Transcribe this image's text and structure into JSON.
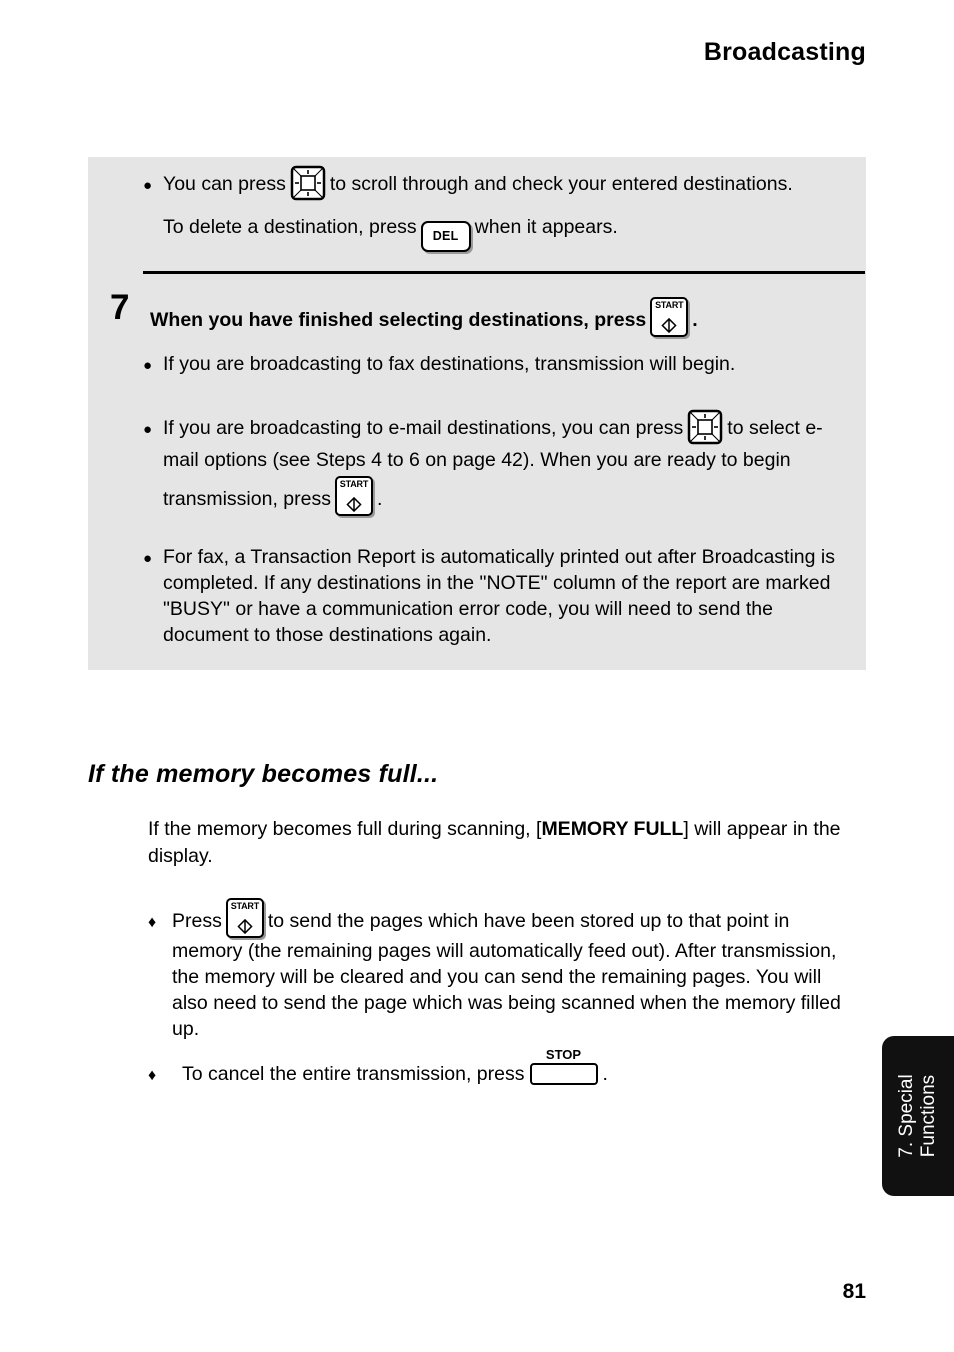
{
  "header": {
    "title": "Broadcasting"
  },
  "callout": {
    "note": {
      "bullet_glyph": "●",
      "line1_before": "You can press",
      "line1_after": "to scroll through and check your entered destinations.",
      "line2_before": "To delete a destination, press",
      "line2_after": "when it appears.",
      "nav_key_name": "arrow-keys",
      "del_key_label": "DEL"
    },
    "step": {
      "number": "7",
      "text_before": "When you have finished selecting destinations, press",
      "text_after": ".",
      "start_key_label": "START"
    },
    "bullets": [
      {
        "glyph": "●",
        "text": "If you are broadcasting to fax destinations, transmission will begin."
      },
      {
        "glyph": "●",
        "seg1": "If you are broadcasting to e-mail destinations, you can press",
        "seg2": "to select e-mail options (see Steps 4 to 6 on page 42). When you are ready to begin transmission, press",
        "seg3": "."
      },
      {
        "glyph": "●",
        "text": "For fax, a Transaction Report is automatically printed out after Broadcasting is completed. If any destinations in the \"NOTE\" column of the report are marked \"BUSY\" or have a communication error code, you will need to send the document to those destinations again."
      }
    ]
  },
  "section": {
    "heading": "If the memory becomes full...",
    "intro_before": "If the memory becomes full during scanning, [",
    "intro_bold": "MEMORY FULL",
    "intro_after": "] will appear in the display.",
    "bullets": [
      {
        "glyph": "♦",
        "seg1": "Press",
        "seg2": "to send the pages which have been stored up to that point in memory (the remaining pages will automatically feed out). After transmission, the memory will be cleared and you can send the remaining pages. You will also need to send the page which was being scanned when the memory filled up."
      },
      {
        "glyph": "♦",
        "seg1": "To cancel the entire transmission, press",
        "seg2": ".",
        "stop_key_label": "STOP"
      }
    ]
  },
  "side_tab": {
    "line1": "7. Special",
    "line2": "Functions"
  },
  "footer": {
    "page_number": "81"
  },
  "colors": {
    "callout_background": "#e5e5e5",
    "side_tab_background": "#111111",
    "text": "#000000",
    "key_shadow": "#9a9a9a"
  }
}
